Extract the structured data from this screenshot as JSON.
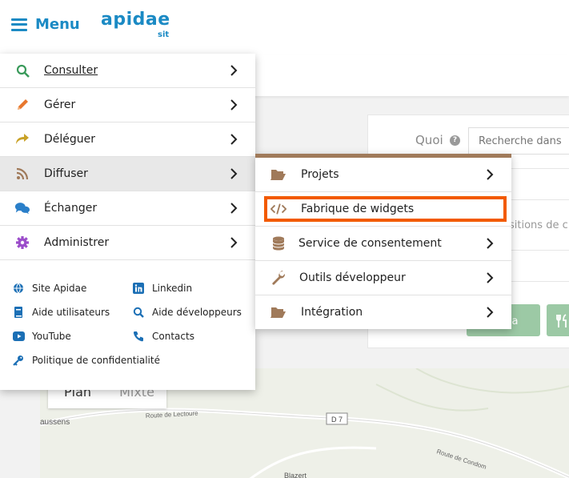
{
  "header": {
    "menu_label": "Menu",
    "logo": "apidae",
    "logo_sub": "sit"
  },
  "background": {
    "quoi_label": "Quoi",
    "search_placeholder": "Recherche dans",
    "positions_text": "sitions de c",
    "agenda_label": "nda",
    "map_tabs": [
      "Plan",
      "Mixte"
    ],
    "map_labels": [
      "aussens",
      "Route de Lectoure",
      "D 7",
      "Route de Condom",
      "Blazert"
    ]
  },
  "main_menu": {
    "items": [
      {
        "label": "Consulter",
        "icon": "search-icon",
        "color": "#3a9a5b"
      },
      {
        "label": "Gérer",
        "icon": "pencil-icon",
        "color": "#e8772e"
      },
      {
        "label": "Déléguer",
        "icon": "share-icon",
        "color": "#c9a227"
      },
      {
        "label": "Diffuser",
        "icon": "rss-icon",
        "color": "#a07a5a"
      },
      {
        "label": "Échanger",
        "icon": "chat-icon",
        "color": "#2a7fc9"
      },
      {
        "label": "Administrer",
        "icon": "gear-icon",
        "color": "#9b4dca"
      }
    ],
    "links": [
      {
        "label": "Site Apidae",
        "icon": "globe-icon"
      },
      {
        "label": "Linkedin",
        "icon": "linkedin-icon"
      },
      {
        "label": "Aide utilisateurs",
        "icon": "book-icon"
      },
      {
        "label": "Aide développeurs",
        "icon": "search-icon"
      },
      {
        "label": "YouTube",
        "icon": "youtube-icon"
      },
      {
        "label": "Contacts",
        "icon": "phone-icon"
      },
      {
        "label": "Politique de confidentialité",
        "icon": "key-icon"
      }
    ]
  },
  "sub_menu": {
    "accent": "#a07a5a",
    "highlight_color": "#f25a00",
    "items": [
      {
        "label": "Projets",
        "icon": "folder-open-icon",
        "has_children": true
      },
      {
        "label": "Fabrique de widgets",
        "icon": "code-icon",
        "has_children": false
      },
      {
        "label": "Service de consentement",
        "icon": "database-icon",
        "has_children": true
      },
      {
        "label": "Outils développeur",
        "icon": "wrench-icon",
        "has_children": true
      },
      {
        "label": "Intégration",
        "icon": "folder-open-icon",
        "has_children": true
      }
    ]
  }
}
